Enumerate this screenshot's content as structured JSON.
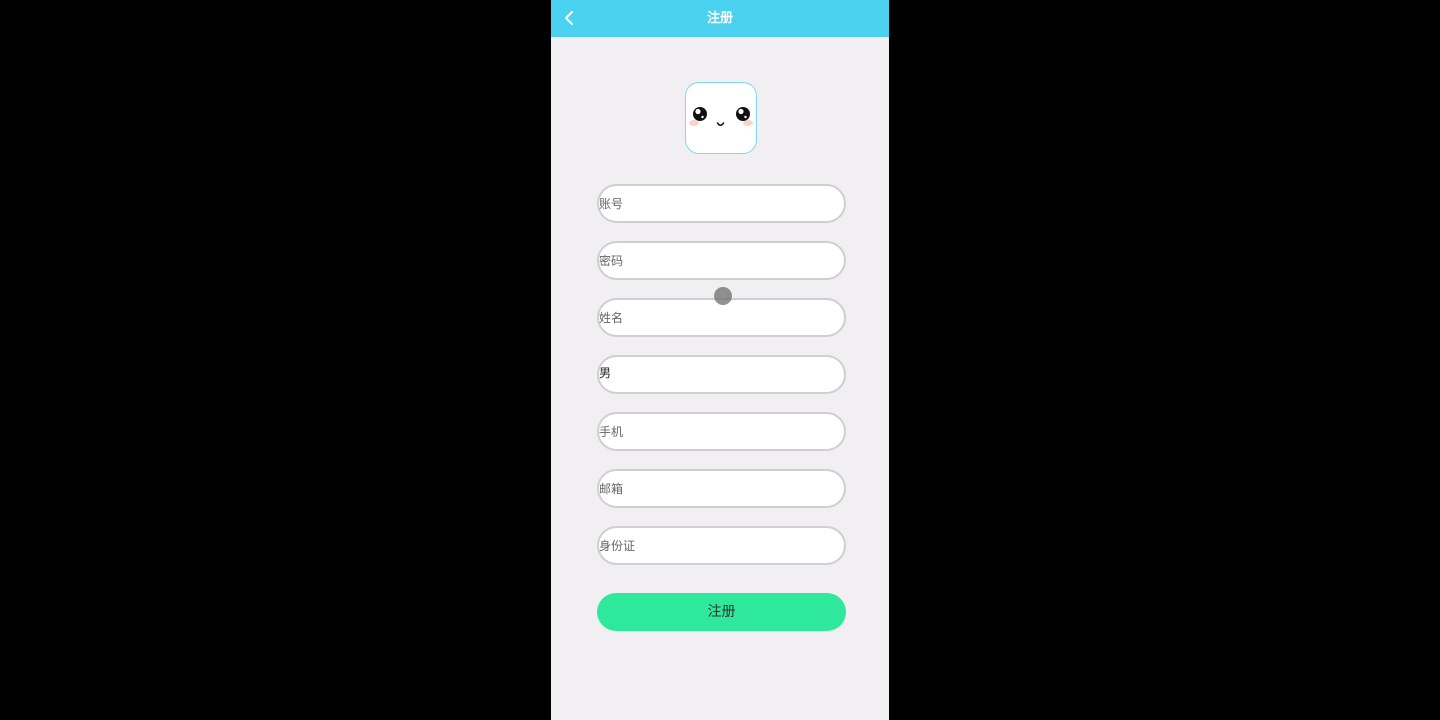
{
  "header": {
    "title": "注册",
    "back_icon": "chevron-left-icon",
    "background_color": "#4bd2f1"
  },
  "avatar": {
    "icon": "cute-face-icon"
  },
  "form": {
    "account_placeholder": "账号",
    "password_placeholder": "密码",
    "name_placeholder": "姓名",
    "gender_value": "男",
    "phone_placeholder": "手机",
    "email_placeholder": "邮箱",
    "id_card_placeholder": "身份证"
  },
  "submit": {
    "label": "注册",
    "color": "#2ee89c"
  }
}
